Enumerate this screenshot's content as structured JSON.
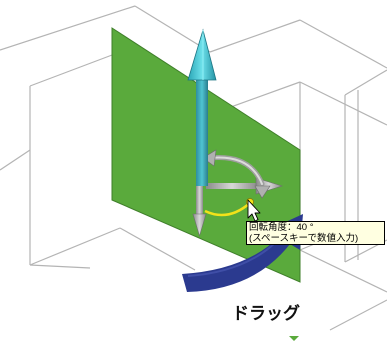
{
  "tooltip": {
    "line1": "回転角度：40 °",
    "line2": "(スペースキーで数値入力)"
  },
  "drag_label": "ドラッグ",
  "colors": {
    "plane": "#5aaa3c",
    "plane_edge": "#3f7f2a",
    "axis_main": "#35a6b6",
    "axis_tip": "#39c8d6",
    "drag_arrow": "#2b3a8f",
    "rotation_arc": "#f2e21a",
    "wireframe": "#b4b4b4",
    "gizmo_gray": "#a8a8a8"
  },
  "icons": {
    "cursor": "mouse-pointer-icon",
    "drag_arrow": "curved-arrow-icon",
    "gizmo": "rotation-gizmo-icon"
  }
}
